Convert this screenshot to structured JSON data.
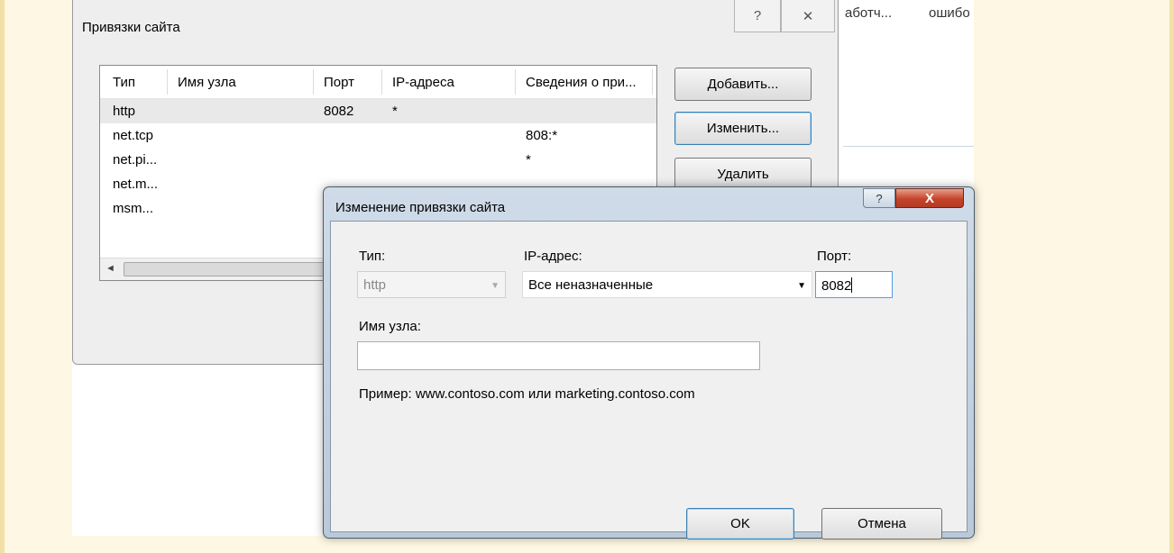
{
  "background": {
    "col_a": "аботч...",
    "col_b": "ошибо"
  },
  "bindings_window": {
    "title": "Привязки сайта",
    "help_glyph": "?",
    "close_glyph": "✕",
    "columns": [
      "Тип",
      "Имя узла",
      "Порт",
      "IP-адреса",
      "Сведения о при..."
    ],
    "rows": [
      {
        "type": "http",
        "host": "",
        "port": "8082",
        "ip": "*",
        "info": ""
      },
      {
        "type": "net.tcp",
        "host": "",
        "port": "",
        "ip": "",
        "info": "808:*"
      },
      {
        "type": "net.pi...",
        "host": "",
        "port": "",
        "ip": "",
        "info": "*"
      },
      {
        "type": "net.m...",
        "host": "",
        "port": "",
        "ip": "",
        "info": ""
      },
      {
        "type": "msm...",
        "host": "",
        "port": "",
        "ip": "",
        "info": ""
      }
    ],
    "buttons": {
      "add": "Добавить...",
      "edit": "Изменить...",
      "remove": "Удалить"
    },
    "scroll_left_glyph": "◄"
  },
  "edit_dialog": {
    "title": "Изменение привязки сайта",
    "help_glyph": "?",
    "close_glyph": "X",
    "type_label": "Тип:",
    "type_value": "http",
    "ip_label": "IP-адрес:",
    "ip_value": "Все неназначенные",
    "port_label": "Порт:",
    "port_value": "8082",
    "host_label": "Имя узла:",
    "host_value": "",
    "example_text": "Пример: www.contoso.com или marketing.contoso.com",
    "ok_label": "OK",
    "cancel_label": "Отмена"
  },
  "colors": {
    "page_background": "#fdf7e3",
    "dialog_frame": "#b9c9da",
    "close_button": "#c4432a"
  }
}
